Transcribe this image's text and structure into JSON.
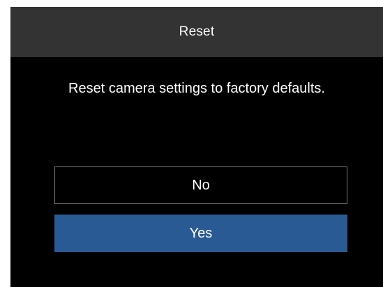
{
  "dialog": {
    "title": "Reset",
    "message": "Reset camera settings to factory defaults.",
    "options": [
      {
        "label": "No",
        "selected": false
      },
      {
        "label": "Yes",
        "selected": true
      }
    ]
  },
  "colors": {
    "background": "#000000",
    "title_bar": "#333333",
    "text": "#ffffff",
    "selected_option": "#2a5a93",
    "option_border": "#7a7a7a"
  }
}
